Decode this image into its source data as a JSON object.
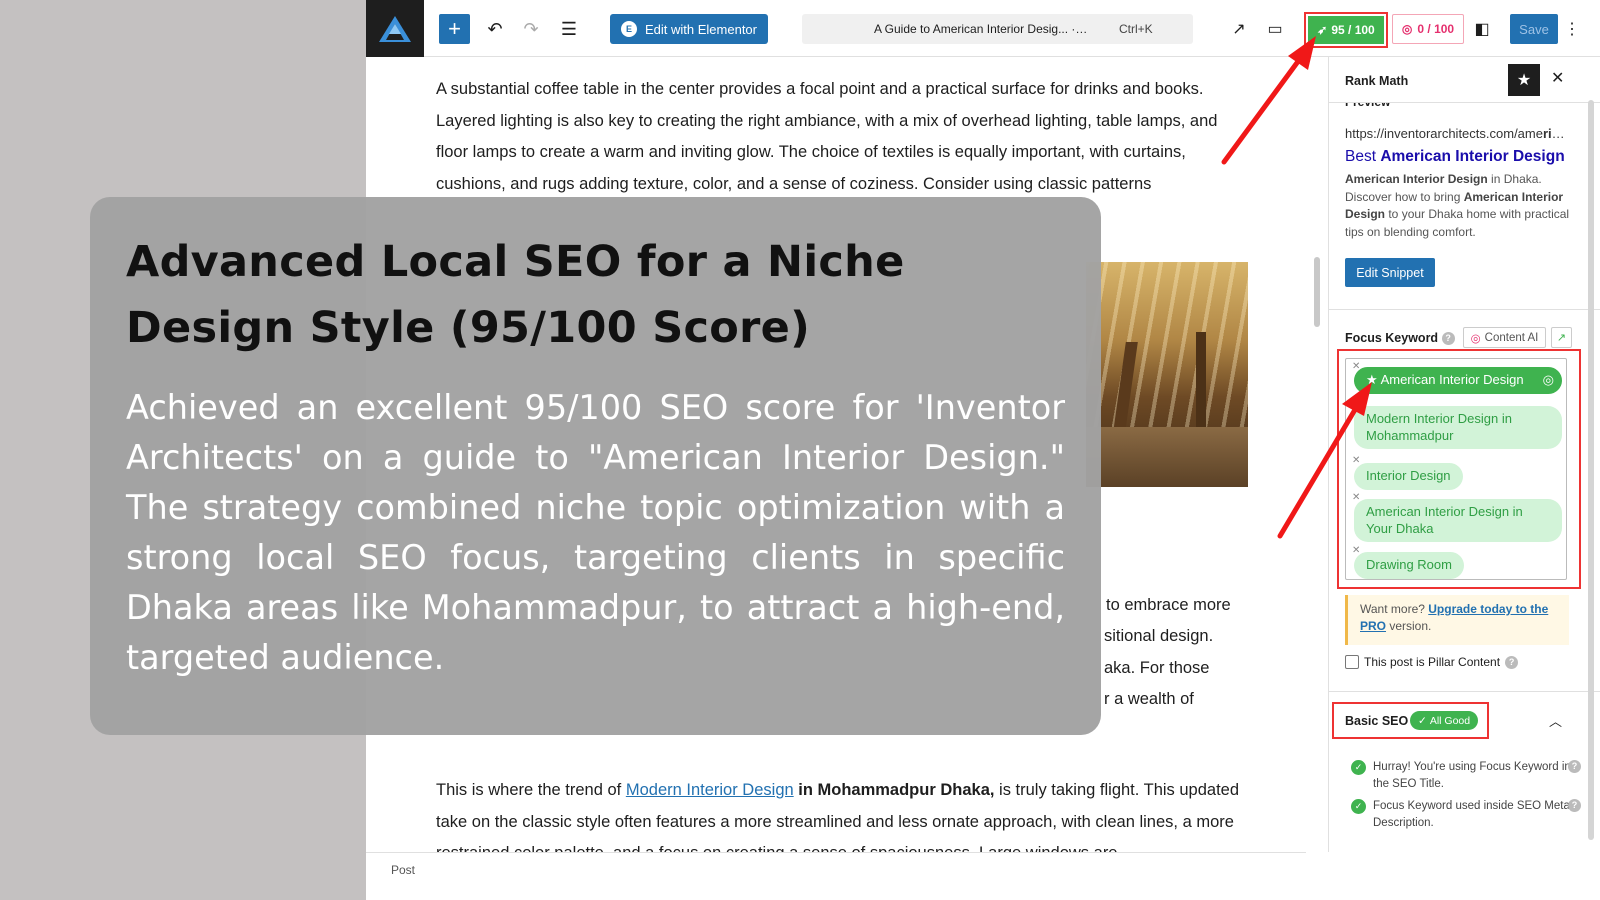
{
  "topbar": {
    "edit_with_elementor": "Edit with Elementor",
    "command_title": "A Guide to American Interior Desig... · Post",
    "shortcut": "Ctrl+K",
    "rank_math_score": "95 / 100",
    "content_ai_score": "0 / 100",
    "save_label": "Save"
  },
  "article": {
    "p1": "A substantial coffee table in the center provides a focal point and a practical surface for drinks and books. Layered lighting is also key to creating the right ambiance, with a mix of overhead lighting, table lamps, and floor lamps to create a warm and inviting glow. The choice of textiles is equally important, with curtains, cushions, and rugs adding texture, color, and a sense of coziness. Consider using classic patterns",
    "frag1": "to embrace more",
    "frag2": "sitional design.",
    "frag3": "aka. For those",
    "frag4": "r a wealth of",
    "p2_pre": "This is where the trend of ",
    "p2_link": "Modern Interior Design",
    "p2_bold": " in Mohammadpur Dhaka,",
    "p2_post": " is truly taking flight. This updated take on the classic style often features a more streamlined and less ornate approach, with clean lines, a more restrained color palette, and a focus on creating a sense of spaciousness. Large windows are"
  },
  "statusbar": {
    "label": "Post"
  },
  "sidebar": {
    "title": "Rank Math",
    "preview_label": "Preview",
    "serp": {
      "url": "https://inventorarchitects.com/ame",
      "url_bold": "rican-interior-design",
      "title_pre": "Best ",
      "title_bold": "American Interior Design",
      "desc_b1": "American Interior Design",
      "desc_t1": " in Dhaka. Discover how to bring ",
      "desc_b2": "American Interior Design",
      "desc_t2": " to your Dhaka home with practical tips on blending comfort."
    },
    "edit_snippet": "Edit Snippet",
    "focus_keyword_label": "Focus Keyword",
    "content_ai": "Content AI",
    "keywords": [
      "American Interior Design",
      "Modern Interior Design in Mohammadpur",
      "Interior Design",
      "American Interior Design in Your Dhaka",
      "Drawing Room"
    ],
    "want_more": "Want more?",
    "upgrade_link": "Upgrade today to the PRO",
    "want_more_tail": " version.",
    "pillar_label": "This post is Pillar Content",
    "basic_seo_label": "Basic SEO",
    "all_good": "All Good",
    "checks": [
      "Hurray! You're using Focus Keyword in the SEO Title.",
      "Focus Keyword used inside SEO Meta Description."
    ]
  },
  "overlay": {
    "title": "Advanced Local SEO for a Niche Design Style (95/100 Score)",
    "body": "Achieved an excellent 95/100 SEO score for 'Inventor Architects' on a guide to \"American Interior Design.\" The strategy combined niche topic optimization with a strong local SEO focus, targeting clients in specific Dhaka areas like Mohammadpur, to attract a high-end, targeted audience."
  },
  "colors": {
    "wp_blue": "#2271b1",
    "rank_math_green": "#3fb34f",
    "highlight_red": "#e33333",
    "content_ai_pink": "#e5306e"
  }
}
